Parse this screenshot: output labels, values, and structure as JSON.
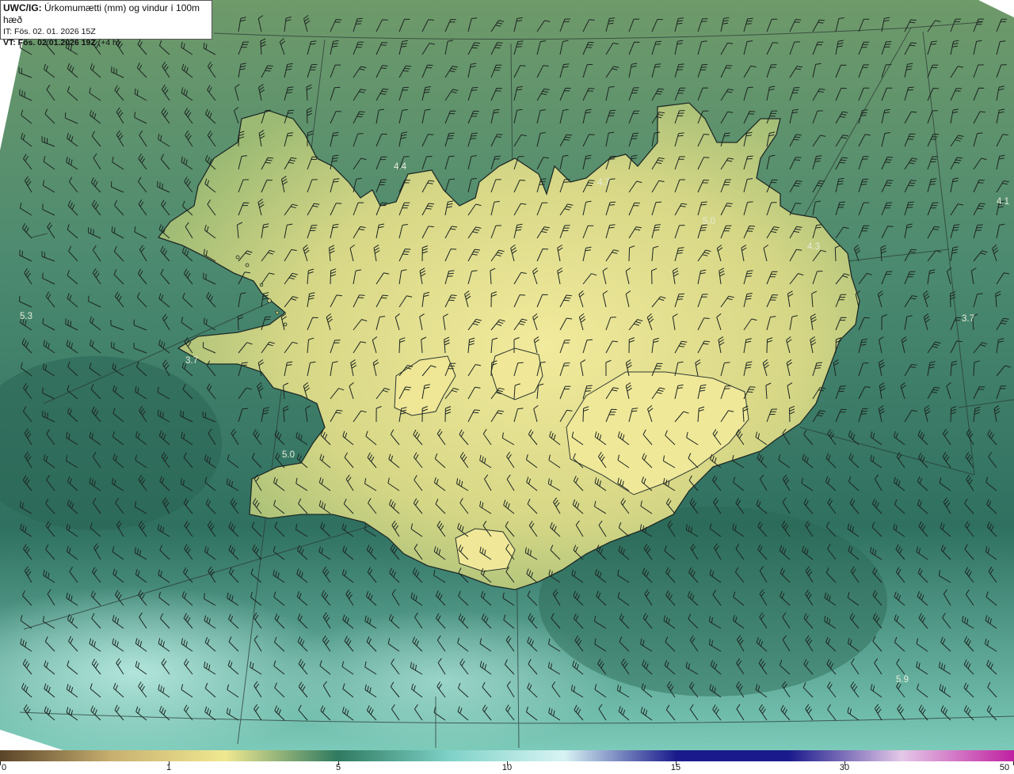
{
  "header": {
    "product": "UWC/IG:",
    "description": "Úrkomumætti (mm) og vindur í 100m hæð",
    "it_line": "IT: Fös. 02. 01. 2026 15Z",
    "vt_label": "VT: Fös. 02.01.2026 19Z",
    "vt_offset": "(+4 h)"
  },
  "map_labels": [
    {
      "id": "wfjords-w",
      "text": "5.3"
    },
    {
      "id": "snaefells",
      "text": "3.7"
    },
    {
      "id": "north-w",
      "text": "4.4"
    },
    {
      "id": "north-c",
      "text": "4.7"
    },
    {
      "id": "north-e",
      "text": "5.0"
    },
    {
      "id": "east-n",
      "text": "4.3"
    },
    {
      "id": "east-off",
      "text": "3.7"
    },
    {
      "id": "far-ne",
      "text": "4.1"
    },
    {
      "id": "reykjanes",
      "text": "5.0"
    },
    {
      "id": "se-off",
      "text": "5.9"
    }
  ],
  "colorbar": {
    "ticks": [
      "0",
      "1",
      "5",
      "10",
      "15",
      "30",
      "50"
    ],
    "colors": [
      "#5a4428",
      "#c8b070",
      "#f0e890",
      "#2f7a60",
      "#7fd2c8",
      "#d8f4f4",
      "#1a1a8c",
      "#1a1a8c",
      "#e4c8e8",
      "#c020a0"
    ]
  },
  "colors": {
    "sea_dark": "#2e6e5a",
    "sea_mid": "#4f9074",
    "sea_light": "#7fc8b8",
    "land_high": "#efe79a",
    "land_low": "#b8c878",
    "coast": "#1e2a26"
  }
}
